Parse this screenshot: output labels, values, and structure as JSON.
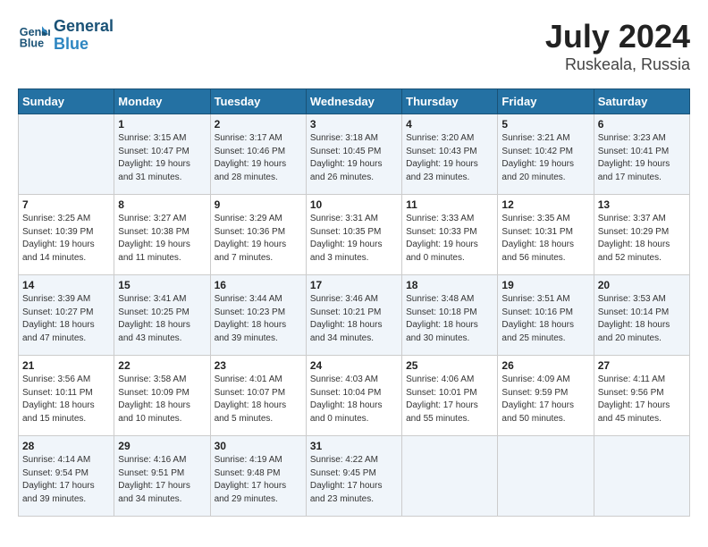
{
  "header": {
    "logo_line1": "General",
    "logo_line2": "Blue",
    "month_year": "July 2024",
    "location": "Ruskeala, Russia"
  },
  "days_of_week": [
    "Sunday",
    "Monday",
    "Tuesday",
    "Wednesday",
    "Thursday",
    "Friday",
    "Saturday"
  ],
  "weeks": [
    [
      {
        "day": "",
        "sunrise": "",
        "sunset": "",
        "daylight": ""
      },
      {
        "day": "1",
        "sunrise": "Sunrise: 3:15 AM",
        "sunset": "Sunset: 10:47 PM",
        "daylight": "Daylight: 19 hours and 31 minutes."
      },
      {
        "day": "2",
        "sunrise": "Sunrise: 3:17 AM",
        "sunset": "Sunset: 10:46 PM",
        "daylight": "Daylight: 19 hours and 28 minutes."
      },
      {
        "day": "3",
        "sunrise": "Sunrise: 3:18 AM",
        "sunset": "Sunset: 10:45 PM",
        "daylight": "Daylight: 19 hours and 26 minutes."
      },
      {
        "day": "4",
        "sunrise": "Sunrise: 3:20 AM",
        "sunset": "Sunset: 10:43 PM",
        "daylight": "Daylight: 19 hours and 23 minutes."
      },
      {
        "day": "5",
        "sunrise": "Sunrise: 3:21 AM",
        "sunset": "Sunset: 10:42 PM",
        "daylight": "Daylight: 19 hours and 20 minutes."
      },
      {
        "day": "6",
        "sunrise": "Sunrise: 3:23 AM",
        "sunset": "Sunset: 10:41 PM",
        "daylight": "Daylight: 19 hours and 17 minutes."
      }
    ],
    [
      {
        "day": "7",
        "sunrise": "Sunrise: 3:25 AM",
        "sunset": "Sunset: 10:39 PM",
        "daylight": "Daylight: 19 hours and 14 minutes."
      },
      {
        "day": "8",
        "sunrise": "Sunrise: 3:27 AM",
        "sunset": "Sunset: 10:38 PM",
        "daylight": "Daylight: 19 hours and 11 minutes."
      },
      {
        "day": "9",
        "sunrise": "Sunrise: 3:29 AM",
        "sunset": "Sunset: 10:36 PM",
        "daylight": "Daylight: 19 hours and 7 minutes."
      },
      {
        "day": "10",
        "sunrise": "Sunrise: 3:31 AM",
        "sunset": "Sunset: 10:35 PM",
        "daylight": "Daylight: 19 hours and 3 minutes."
      },
      {
        "day": "11",
        "sunrise": "Sunrise: 3:33 AM",
        "sunset": "Sunset: 10:33 PM",
        "daylight": "Daylight: 19 hours and 0 minutes."
      },
      {
        "day": "12",
        "sunrise": "Sunrise: 3:35 AM",
        "sunset": "Sunset: 10:31 PM",
        "daylight": "Daylight: 18 hours and 56 minutes."
      },
      {
        "day": "13",
        "sunrise": "Sunrise: 3:37 AM",
        "sunset": "Sunset: 10:29 PM",
        "daylight": "Daylight: 18 hours and 52 minutes."
      }
    ],
    [
      {
        "day": "14",
        "sunrise": "Sunrise: 3:39 AM",
        "sunset": "Sunset: 10:27 PM",
        "daylight": "Daylight: 18 hours and 47 minutes."
      },
      {
        "day": "15",
        "sunrise": "Sunrise: 3:41 AM",
        "sunset": "Sunset: 10:25 PM",
        "daylight": "Daylight: 18 hours and 43 minutes."
      },
      {
        "day": "16",
        "sunrise": "Sunrise: 3:44 AM",
        "sunset": "Sunset: 10:23 PM",
        "daylight": "Daylight: 18 hours and 39 minutes."
      },
      {
        "day": "17",
        "sunrise": "Sunrise: 3:46 AM",
        "sunset": "Sunset: 10:21 PM",
        "daylight": "Daylight: 18 hours and 34 minutes."
      },
      {
        "day": "18",
        "sunrise": "Sunrise: 3:48 AM",
        "sunset": "Sunset: 10:18 PM",
        "daylight": "Daylight: 18 hours and 30 minutes."
      },
      {
        "day": "19",
        "sunrise": "Sunrise: 3:51 AM",
        "sunset": "Sunset: 10:16 PM",
        "daylight": "Daylight: 18 hours and 25 minutes."
      },
      {
        "day": "20",
        "sunrise": "Sunrise: 3:53 AM",
        "sunset": "Sunset: 10:14 PM",
        "daylight": "Daylight: 18 hours and 20 minutes."
      }
    ],
    [
      {
        "day": "21",
        "sunrise": "Sunrise: 3:56 AM",
        "sunset": "Sunset: 10:11 PM",
        "daylight": "Daylight: 18 hours and 15 minutes."
      },
      {
        "day": "22",
        "sunrise": "Sunrise: 3:58 AM",
        "sunset": "Sunset: 10:09 PM",
        "daylight": "Daylight: 18 hours and 10 minutes."
      },
      {
        "day": "23",
        "sunrise": "Sunrise: 4:01 AM",
        "sunset": "Sunset: 10:07 PM",
        "daylight": "Daylight: 18 hours and 5 minutes."
      },
      {
        "day": "24",
        "sunrise": "Sunrise: 4:03 AM",
        "sunset": "Sunset: 10:04 PM",
        "daylight": "Daylight: 18 hours and 0 minutes."
      },
      {
        "day": "25",
        "sunrise": "Sunrise: 4:06 AM",
        "sunset": "Sunset: 10:01 PM",
        "daylight": "Daylight: 17 hours and 55 minutes."
      },
      {
        "day": "26",
        "sunrise": "Sunrise: 4:09 AM",
        "sunset": "Sunset: 9:59 PM",
        "daylight": "Daylight: 17 hours and 50 minutes."
      },
      {
        "day": "27",
        "sunrise": "Sunrise: 4:11 AM",
        "sunset": "Sunset: 9:56 PM",
        "daylight": "Daylight: 17 hours and 45 minutes."
      }
    ],
    [
      {
        "day": "28",
        "sunrise": "Sunrise: 4:14 AM",
        "sunset": "Sunset: 9:54 PM",
        "daylight": "Daylight: 17 hours and 39 minutes."
      },
      {
        "day": "29",
        "sunrise": "Sunrise: 4:16 AM",
        "sunset": "Sunset: 9:51 PM",
        "daylight": "Daylight: 17 hours and 34 minutes."
      },
      {
        "day": "30",
        "sunrise": "Sunrise: 4:19 AM",
        "sunset": "Sunset: 9:48 PM",
        "daylight": "Daylight: 17 hours and 29 minutes."
      },
      {
        "day": "31",
        "sunrise": "Sunrise: 4:22 AM",
        "sunset": "Sunset: 9:45 PM",
        "daylight": "Daylight: 17 hours and 23 minutes."
      },
      {
        "day": "",
        "sunrise": "",
        "sunset": "",
        "daylight": ""
      },
      {
        "day": "",
        "sunrise": "",
        "sunset": "",
        "daylight": ""
      },
      {
        "day": "",
        "sunrise": "",
        "sunset": "",
        "daylight": ""
      }
    ]
  ]
}
